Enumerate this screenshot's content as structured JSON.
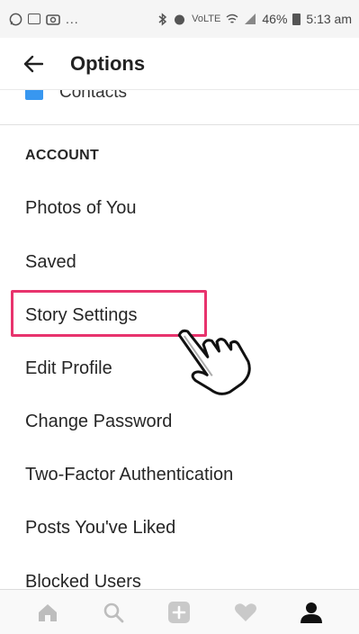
{
  "status_bar": {
    "left_text": "...",
    "battery": "46%",
    "time": "5:13 am",
    "signal_label": "VoLTE",
    "icons_left": [
      "whatsapp-icon",
      "gallery-icon",
      "camera-icon"
    ],
    "icons_right": [
      "bluetooth-icon",
      "alarm-icon",
      "wifi-icon",
      "signal-icon",
      "battery-icon"
    ]
  },
  "header": {
    "title": "Options"
  },
  "list": {
    "contacts_label": "Contacts",
    "section_title": "ACCOUNT",
    "items": [
      {
        "label": "Photos of You"
      },
      {
        "label": "Saved"
      },
      {
        "label": "Story Settings"
      },
      {
        "label": "Edit Profile"
      },
      {
        "label": "Change Password"
      },
      {
        "label": "Two-Factor Authentication"
      },
      {
        "label": "Posts You've Liked"
      },
      {
        "label": "Blocked Users"
      }
    ],
    "highlighted_item": "Story Settings"
  },
  "bottom_nav": {
    "items": [
      "home-icon",
      "search-icon",
      "add-icon",
      "heart-icon",
      "profile-icon"
    ],
    "active": "profile-icon"
  },
  "colors": {
    "highlight": "#e8336d",
    "accent_blue": "#3897f0",
    "text": "#262626"
  }
}
